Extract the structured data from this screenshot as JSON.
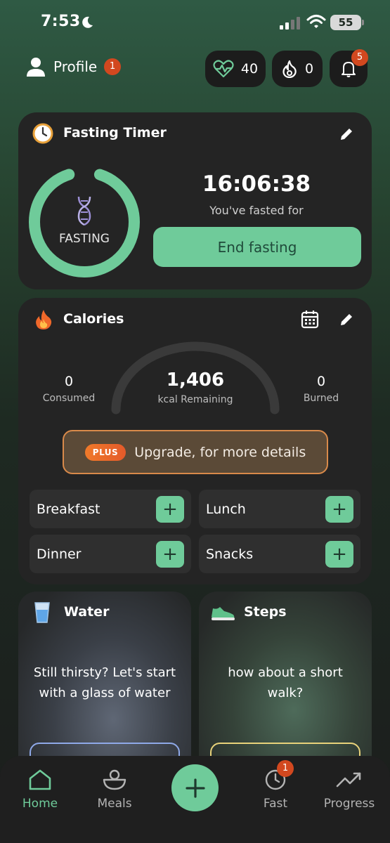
{
  "status_bar": {
    "time": "7:53",
    "battery": "55"
  },
  "header": {
    "profile_label": "Profile",
    "profile_badge": "1",
    "health_score": "40",
    "flame_count": "0",
    "notification_count": "5"
  },
  "fasting": {
    "title": "Fasting Timer",
    "state_label": "FASTING",
    "elapsed": "16:06:38",
    "subtitle": "You've fasted for",
    "end_button": "End fasting",
    "ring_progress": 0.9
  },
  "calories": {
    "title": "Calories",
    "consumed_value": "0",
    "consumed_label": "Consumed",
    "remaining_value": "1,406",
    "remaining_label": "kcal Remaining",
    "burned_value": "0",
    "burned_label": "Burned",
    "upgrade_badge": "PLUS",
    "upgrade_text": "Upgrade, for more details",
    "meals": [
      "Breakfast",
      "Lunch",
      "Dinner",
      "Snacks"
    ]
  },
  "water": {
    "title": "Water",
    "message": "Still thirsty? Let's start with a glass of water"
  },
  "steps": {
    "title": "Steps",
    "message": "how about a short walk?"
  },
  "nav": {
    "home": "Home",
    "meals": "Meals",
    "fast": "Fast",
    "fast_badge": "1",
    "progress": "Progress"
  },
  "colors": {
    "accent": "#6fcb9a",
    "badge": "#d2481f",
    "card": "#242424"
  }
}
